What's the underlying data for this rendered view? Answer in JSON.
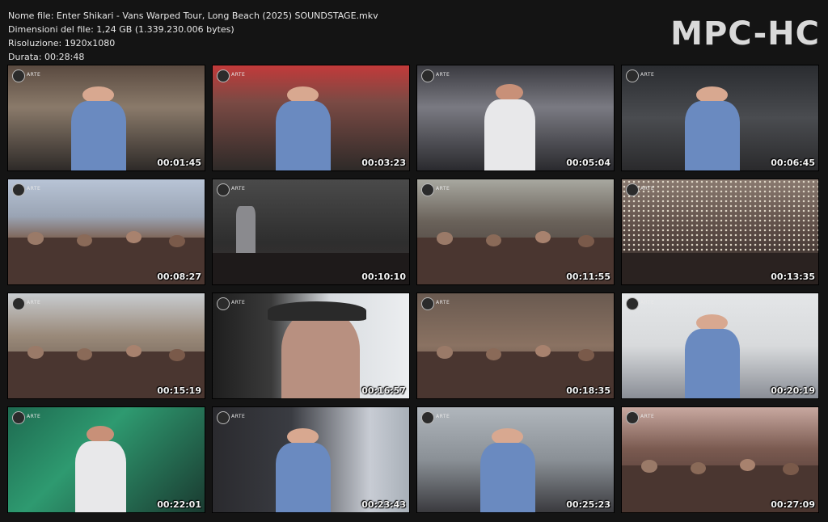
{
  "info": {
    "filename": "Nome file: Enter Shikari - Vans Warped Tour, Long Beach (2025) SOUNDSTAGE.mkv",
    "filesize": "Dimensioni del file: 1,24 GB (1.339.230.006 bytes)",
    "resolution": "Risoluzione: 1920x1080",
    "duration": "Durata: 00:28:48"
  },
  "logo": "MPC-HC",
  "channel_logo": "ARTE",
  "thumbnails": [
    {
      "time": "00:01:45",
      "bg": "linear-gradient(180deg,#5a4a40 0%,#8a7a6a 40%,#2e2a28 100%)",
      "shape": "person-blue"
    },
    {
      "time": "00:03:23",
      "bg": "linear-gradient(180deg,#c23a3a 0%,#7a4a44 35%,#2e2a28 100%)",
      "shape": "person-blue"
    },
    {
      "time": "00:05:04",
      "bg": "linear-gradient(180deg,#3a3a40 0%,#7a7a82 40%,#2a2a2e 100%)",
      "shape": "person-white"
    },
    {
      "time": "00:06:45",
      "bg": "linear-gradient(180deg,#2a2c30 0%,#4a4c50 50%,#2a2a2c 100%)",
      "shape": "person-blue"
    },
    {
      "time": "00:08:27",
      "bg": "linear-gradient(180deg,#b8c4d6 0%,#9aa4b4 35%,#7a5a48 60%,#3a2e2a 100%)",
      "shape": "crowd"
    },
    {
      "time": "00:10:10",
      "bg": "linear-gradient(180deg,#4a4a4a 0%,#2e2e2e 60%,#3a3232 100%)",
      "shape": "stage"
    },
    {
      "time": "00:11:55",
      "bg": "linear-gradient(180deg,#a8a8a0 0%,#6a625a 40%,#3a302c 100%)",
      "shape": "crowd"
    },
    {
      "time": "00:13:35",
      "bg": "linear-gradient(180deg,#8a7a70 0%,#5a4a44 50%,#2a2422 100%)",
      "shape": "confetti"
    },
    {
      "time": "00:15:19",
      "bg": "linear-gradient(180deg,#c8ccd0 0%,#9a8a7a 40%,#5a4a40 100%)",
      "shape": "crowd"
    },
    {
      "time": "00:16:57",
      "bg": "linear-gradient(90deg,#1e1e1e 0%,#3a3a3a 30%,#d8dce0 60%,#eceef0 100%)",
      "shape": "closeup"
    },
    {
      "time": "00:18:35",
      "bg": "linear-gradient(180deg,#6a5a50 0%,#8a7262 50%,#4a3a34 100%)",
      "shape": "crowd"
    },
    {
      "time": "00:20:19",
      "bg": "linear-gradient(180deg,#e4e6e8 0%,#d8dadc 50%,#8a8e96 100%)",
      "shape": "person-blue"
    },
    {
      "time": "00:22:01",
      "bg": "linear-gradient(135deg,#1e6a50 0%,#2e9a70 40%,#1a3a30 100%)",
      "shape": "person-white"
    },
    {
      "time": "00:23:43",
      "bg": "linear-gradient(90deg,#2a2a2e 0%,#3a3c42 40%,#c8ccd4 80%,#a8b0b8 100%)",
      "shape": "person-blue"
    },
    {
      "time": "00:25:23",
      "bg": "linear-gradient(180deg,#b0b6bc 0%,#8a9096 50%,#3a3a3e 100%)",
      "shape": "person-blue"
    },
    {
      "time": "00:27:09",
      "bg": "linear-gradient(180deg,#c8a8a0 0%,#7a5a50 40%,#3a2a28 100%)",
      "shape": "crowd"
    }
  ]
}
